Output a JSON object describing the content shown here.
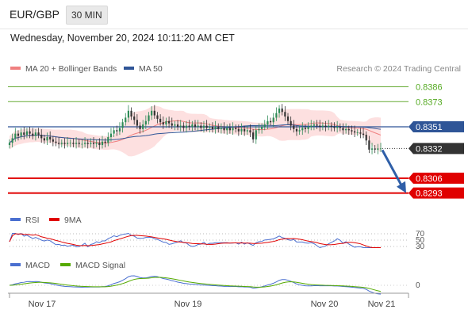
{
  "header": {
    "symbol": "EUR/GBP",
    "timeframe": "30 MIN",
    "datetime": "Wednesday, November 20, 2024 10:11:20 AM CET"
  },
  "legend_main": [
    {
      "label": "MA 20 + Bollinger Bands",
      "color": "#f08080"
    },
    {
      "label": "MA 50",
      "color": "#2f5597"
    }
  ],
  "attribution": "Research © 2024 Trading Central",
  "price_levels": [
    {
      "value": 0.8386,
      "label": "0.8386",
      "kind": "resistance",
      "color": "#66aa33"
    },
    {
      "value": 0.8373,
      "label": "0.8373",
      "kind": "resistance",
      "color": "#66aa33"
    },
    {
      "value": 0.8351,
      "label": "0.8351",
      "kind": "pivot",
      "color": "#2f5597"
    },
    {
      "value": 0.8332,
      "label": "0.8332",
      "kind": "last-price",
      "color": "#333333"
    },
    {
      "value": 0.8306,
      "label": "0.8306",
      "kind": "support",
      "color": "#e00000"
    },
    {
      "value": 0.8293,
      "label": "0.8293",
      "kind": "support",
      "color": "#e00000"
    }
  ],
  "rsi_panel": {
    "legend": [
      {
        "label": "RSI",
        "color": "#4a6fd0"
      },
      {
        "label": "9MA",
        "color": "#e00000"
      }
    ],
    "levels": [
      "70",
      "50",
      "30"
    ]
  },
  "macd_panel": {
    "legend": [
      {
        "label": "MACD",
        "color": "#4a6fd0"
      },
      {
        "label": "MACD Signal",
        "color": "#55aa00"
      }
    ],
    "zero_label": "0"
  },
  "x_axis": {
    "ticks": [
      "Nov 17",
      "Nov 19",
      "Nov 20",
      "Nov 21"
    ]
  },
  "chart_data": {
    "type": "candlestick",
    "x_ticks": [
      "Nov 17",
      "Nov 19",
      "Nov 20",
      "Nov 21"
    ],
    "y_range": [
      0.8283,
      0.8394
    ],
    "last_price": 0.8332,
    "forecast_direction": "down",
    "close": [
      0.8337,
      0.8341,
      0.8345,
      0.8343,
      0.8346,
      0.8344,
      0.8347,
      0.8345,
      0.8343,
      0.8346,
      0.8344,
      0.8341,
      0.8339,
      0.8342,
      0.834,
      0.8338,
      0.8337,
      0.8336,
      0.8337,
      0.8336,
      0.8337,
      0.8337,
      0.8336,
      0.8337,
      0.8336,
      0.8336,
      0.8337,
      0.8336,
      0.8337,
      0.8336,
      0.8337,
      0.8335,
      0.8338,
      0.8337,
      0.8342,
      0.8345,
      0.8348,
      0.8347,
      0.835,
      0.8355,
      0.8359,
      0.8365,
      0.836,
      0.8357,
      0.8352,
      0.8349,
      0.8353,
      0.8356,
      0.8361,
      0.8365,
      0.8361,
      0.8358,
      0.8355,
      0.8353,
      0.8356,
      0.8354,
      0.8352,
      0.8353,
      0.8351,
      0.8352,
      0.835,
      0.8352,
      0.8351,
      0.8353,
      0.8351,
      0.8352,
      0.835,
      0.8352,
      0.835,
      0.8351,
      0.8349,
      0.8351,
      0.8349,
      0.835,
      0.8348,
      0.835,
      0.8348,
      0.835,
      0.8349,
      0.8347,
      0.8349,
      0.8347,
      0.8348,
      0.8346,
      0.834,
      0.8348,
      0.8349,
      0.8351,
      0.8353,
      0.8356,
      0.8355,
      0.8359,
      0.8363,
      0.8367,
      0.8364,
      0.836,
      0.8356,
      0.8352,
      0.8349,
      0.8347,
      0.8348,
      0.835,
      0.8349,
      0.8351,
      0.8352,
      0.8353,
      0.8352,
      0.8351,
      0.8352,
      0.8351,
      0.8352,
      0.8351,
      0.835,
      0.8351,
      0.835,
      0.8348,
      0.8349,
      0.8348,
      0.8347,
      0.8346,
      0.8346,
      0.8345,
      0.8344,
      0.8339,
      0.8331,
      0.8332,
      0.8331,
      0.8332,
      0.8332
    ]
  }
}
